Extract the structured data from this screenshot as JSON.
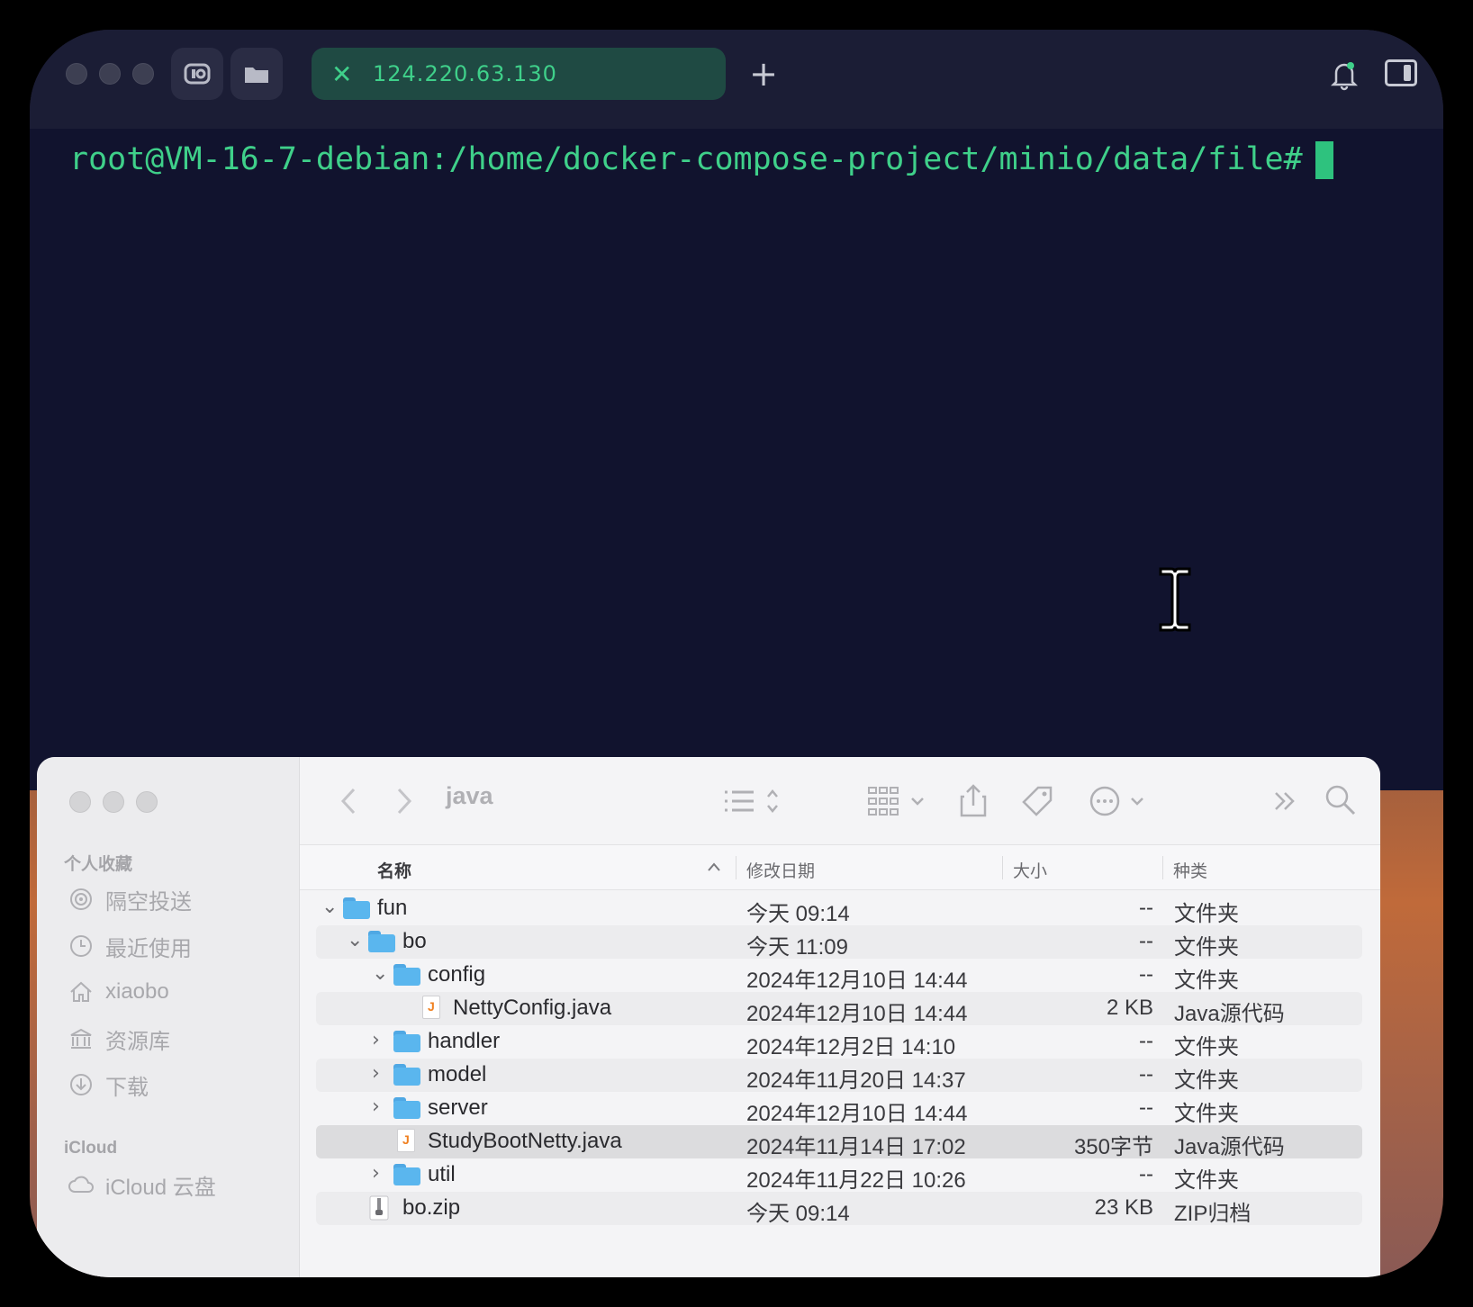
{
  "terminal": {
    "tab_close_glyph": "✕",
    "tab_title": "124.220.63.130",
    "new_tab_glyph": "+",
    "prompt": "root@VM-16-7-debian:/home/docker-compose-project/minio/data/file#",
    "icons": {
      "sftp": "sftp-icon",
      "files": "folder-icon",
      "bell": "bell-icon",
      "panel": "sidebar-toggle-icon"
    },
    "accent": "#3fd08a",
    "background": "#11132e"
  },
  "finder": {
    "title": "java",
    "sidebar": {
      "favorites_label": "个人收藏",
      "favorites": [
        {
          "label": "隔空投送",
          "icon": "airdrop-icon"
        },
        {
          "label": "最近使用",
          "icon": "clock-icon"
        },
        {
          "label": "xiaobo",
          "icon": "home-icon"
        },
        {
          "label": "资源库",
          "icon": "library-icon"
        },
        {
          "label": "下载",
          "icon": "download-icon"
        }
      ],
      "icloud_label": "iCloud",
      "icloud": [
        {
          "label": "iCloud 云盘",
          "icon": "cloud-icon"
        }
      ]
    },
    "columns": {
      "name": "名称",
      "date": "修改日期",
      "size": "大小",
      "kind": "种类"
    },
    "rows": [
      {
        "name": "fun",
        "date": "今天 09:14",
        "size": "--",
        "kind": "文件夹",
        "type": "folder",
        "chevron": "⌄",
        "indent": 0
      },
      {
        "name": "bo",
        "date": "今天 11:09",
        "size": "--",
        "kind": "文件夹",
        "type": "folder",
        "chevron": "⌄",
        "indent": 1
      },
      {
        "name": "config",
        "date": "2024年12月10日 14:44",
        "size": "--",
        "kind": "文件夹",
        "type": "folder",
        "chevron": "⌄",
        "indent": 2
      },
      {
        "name": "NettyConfig.java",
        "date": "2024年12月10日 14:44",
        "size": "2 KB",
        "kind": "Java源代码",
        "type": "java",
        "chevron": "",
        "indent": 3
      },
      {
        "name": "handler",
        "date": "2024年12月2日 14:10",
        "size": "--",
        "kind": "文件夹",
        "type": "folder",
        "chevron": "›",
        "indent": 2
      },
      {
        "name": "model",
        "date": "2024年11月20日 14:37",
        "size": "--",
        "kind": "文件夹",
        "type": "folder",
        "chevron": "›",
        "indent": 2
      },
      {
        "name": "server",
        "date": "2024年12月10日 14:44",
        "size": "--",
        "kind": "文件夹",
        "type": "folder",
        "chevron": "›",
        "indent": 2
      },
      {
        "name": "StudyBootNetty.java",
        "date": "2024年11月14日 17:02",
        "size": "350字节",
        "kind": "Java源代码",
        "type": "java",
        "chevron": "",
        "indent": 2
      },
      {
        "name": "util",
        "date": "2024年11月22日 10:26",
        "size": "--",
        "kind": "文件夹",
        "type": "folder",
        "chevron": "›",
        "indent": 2
      },
      {
        "name": "bo.zip",
        "date": "今天 09:14",
        "size": "23 KB",
        "kind": "ZIP归档",
        "type": "zip",
        "chevron": "",
        "indent": 1
      }
    ]
  }
}
